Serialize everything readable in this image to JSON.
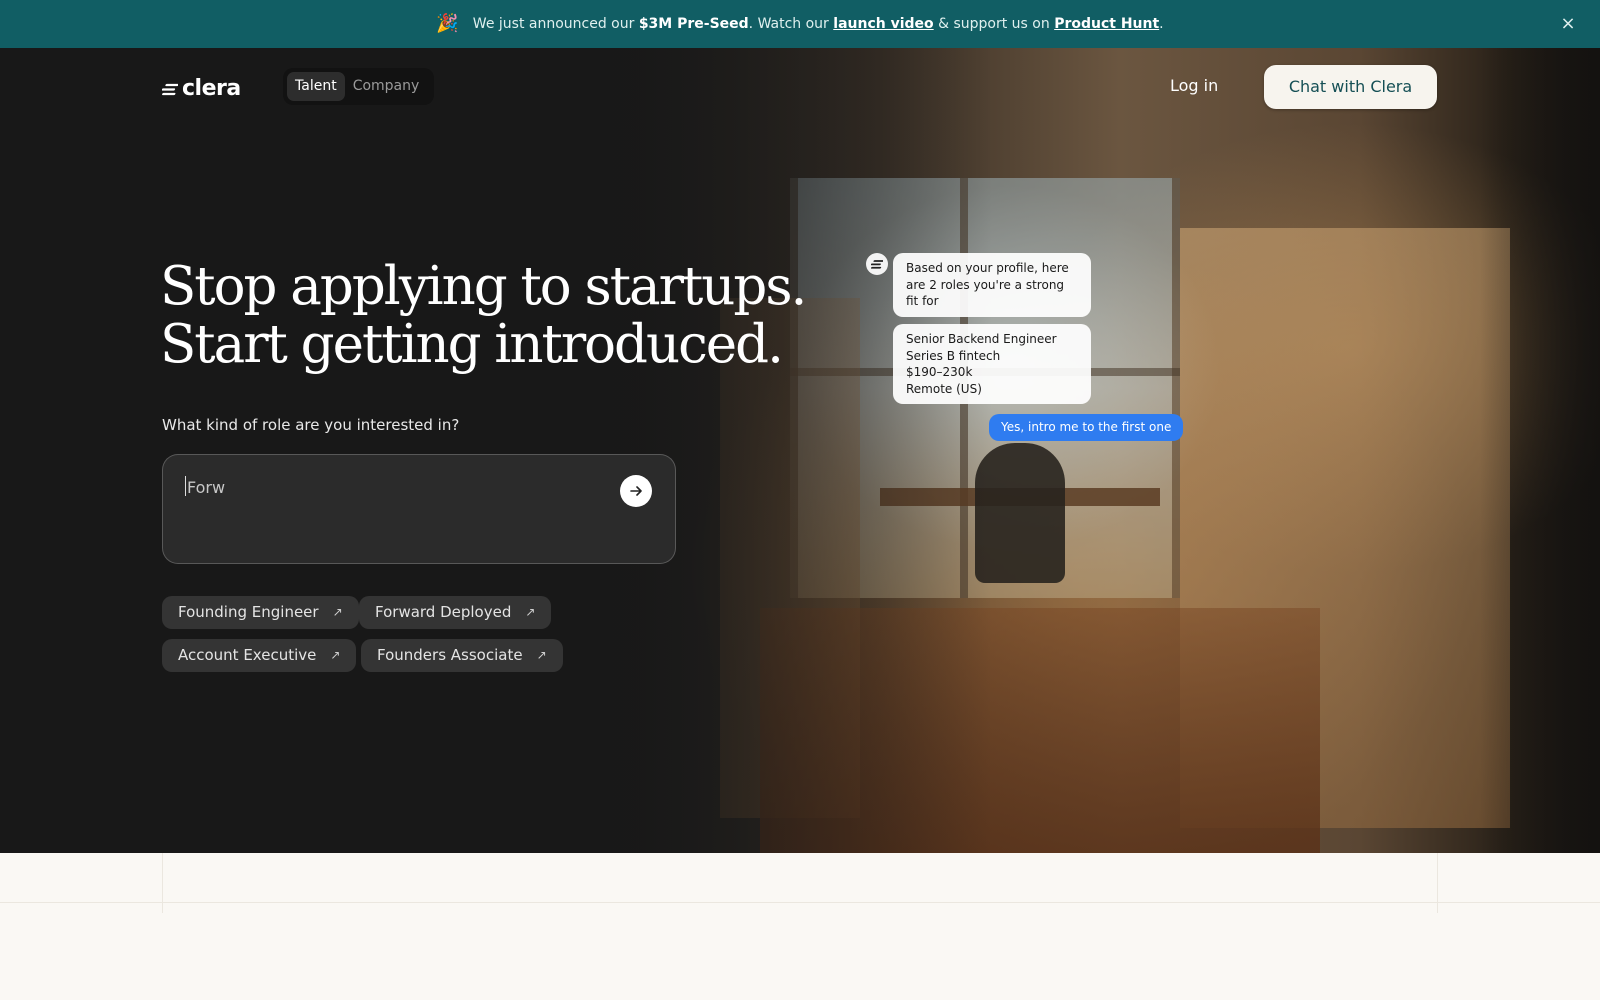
{
  "announcement": {
    "party_icon": "🎉",
    "text_1": "We just announced our ",
    "highlight": "$3M Pre-Seed",
    "text_2": ". Watch our ",
    "link_video": "launch video",
    "text_3": " & support us on ",
    "link_ph": "Product Hunt",
    "text_4": ".",
    "close_icon": "×",
    "bg_color": "#115e64"
  },
  "nav": {
    "logo_text": "clera",
    "toggle": {
      "talent": "Talent",
      "company": "Company",
      "active": "Talent"
    },
    "login": "Log in",
    "cta": "Chat with Clera"
  },
  "hero": {
    "headline_1": "Stop applying to startups.",
    "headline_2": "Start getting introduced.",
    "question": "What kind of role are you interested in?",
    "input_value": "Forw",
    "chips": [
      {
        "label": "Founding Engineer",
        "arrow": "↗"
      },
      {
        "label": "Forward Deployed",
        "arrow": "↗"
      },
      {
        "label": "Account Executive",
        "arrow": "↗"
      },
      {
        "label": "Founders Associate",
        "arrow": "↗"
      }
    ]
  },
  "chat": {
    "bot_message": "Based on your profile, here are 2 roles you're a strong fit for",
    "role": {
      "title": "Senior Backend Engineer",
      "company": "Series B fintech",
      "salary": "$190–230k",
      "location": "Remote (US)"
    },
    "user_reply": "Yes, intro me to the first one"
  },
  "colors": {
    "accent": "#115e64",
    "cta_text": "#154f55",
    "user_bubble": "#2f7cf0",
    "page_bg": "#faf8f4"
  }
}
